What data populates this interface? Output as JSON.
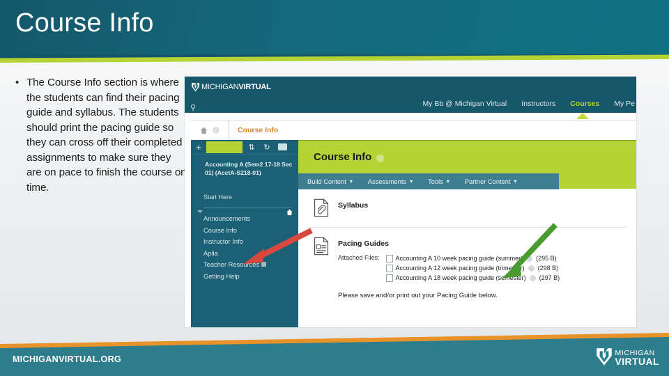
{
  "slide": {
    "title": "Course Info",
    "bullet": "The Course Info section is where the students can find their pacing guide and syllabus. The students should print the pacing guide so they can cross off their completed assignments to make sure they are on pace to finish the course on time.",
    "bullet_marker": "•"
  },
  "colors": {
    "header_teal": "#14697c",
    "accent_green": "#b5d334",
    "footer_orange": "#e8932a",
    "footer_teal": "#2e7d8c",
    "arrow_red": "#d9483c",
    "arrow_green": "#4a9b2f",
    "breadcrumb_orange": "#d08a2c"
  },
  "screenshot": {
    "brand": {
      "prefix": "MICHIGAN",
      "suffix": "VIRTUAL"
    },
    "top_nav": [
      {
        "label": "My Bb @ Michigan Virtual",
        "active": false
      },
      {
        "label": "Instructors",
        "active": false
      },
      {
        "label": "Courses",
        "active": true
      },
      {
        "label": "My Pe",
        "active": false
      }
    ],
    "breadcrumb": {
      "label": "Course Info"
    },
    "sidebar": {
      "toolbar": {
        "add": "+",
        "reorder": "⇅",
        "refresh": "↻",
        "folder": "folder-icon"
      },
      "course_title": "Accounting A (Sem2 17-18 Sec 01) (AcctA-S218-01)",
      "start_here": "Start Here",
      "links": [
        {
          "label": "Announcements",
          "external": false
        },
        {
          "label": "Course Info",
          "external": false
        },
        {
          "label": "Instructor Info",
          "external": false
        },
        {
          "label": "Aplia",
          "external": false
        },
        {
          "label": "Teacher Resources",
          "external": true
        },
        {
          "label": "Getting Help",
          "external": false
        }
      ]
    },
    "page": {
      "title": "Course Info",
      "action_menu": [
        {
          "label": "Build Content",
          "caret": "▾"
        },
        {
          "label": "Assessments",
          "caret": "▾"
        },
        {
          "label": "Tools",
          "caret": "▾"
        },
        {
          "label": "Partner Content",
          "caret": "▾"
        }
      ],
      "items": [
        {
          "title": "Syllabus",
          "icon": "attachment-document-icon"
        },
        {
          "title": "Pacing Guides",
          "icon": "list-document-icon"
        }
      ],
      "attached_files_label": "Attached Files:",
      "attached_files": [
        {
          "name": "Accounting A 10 week pacing guide (summer)",
          "size": "(295 B)"
        },
        {
          "name": "Accounting A 12 week pacing guide (trimester)",
          "size": "(298 B)"
        },
        {
          "name": "Accounting A 18 week pacing guide (semester)",
          "size": "(297 B)"
        }
      ],
      "note": "Please save and/or print out your Pacing Guide below."
    }
  },
  "footer": {
    "url": "MICHIGANVIRTUAL.ORG",
    "logo_line1": "MICHIGAN",
    "logo_line2": "VIRTUAL"
  }
}
